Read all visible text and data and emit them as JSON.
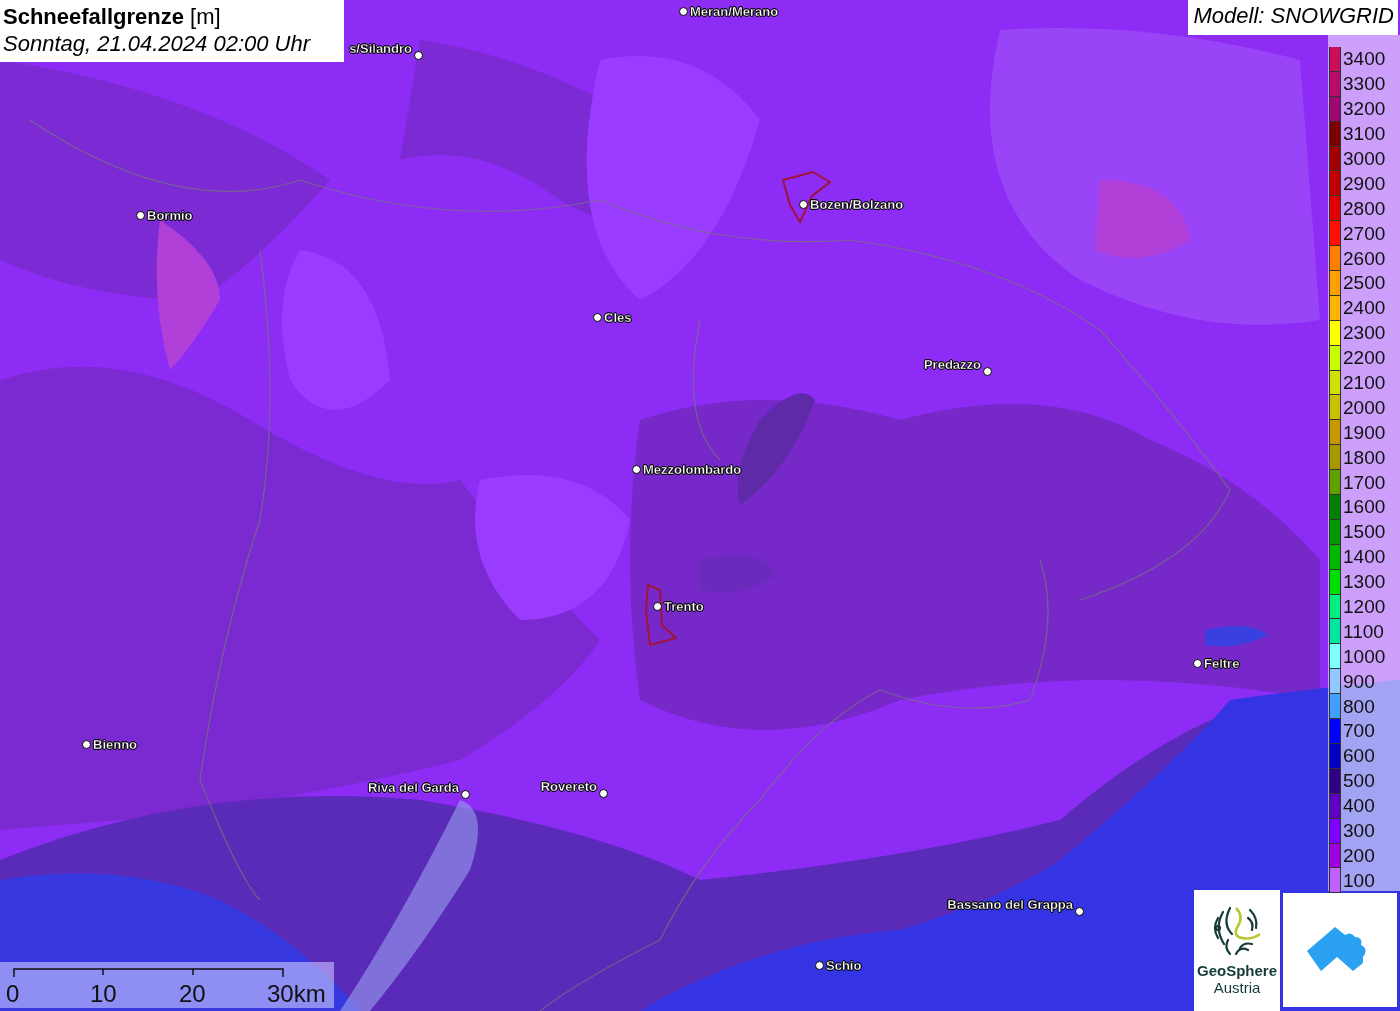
{
  "title": {
    "heading": "**Schneefallgrenze** [m]",
    "datetime": "Sonntag, 21.04.2024 02:00 Uhr"
  },
  "model": "Modell: SNOWGRID",
  "cities": [
    {
      "name": "Meran/Merano"
    },
    {
      "name": "s/Silandro"
    },
    {
      "name": "Bormio"
    },
    {
      "name": "Bozen/Bolzano"
    },
    {
      "name": "Cles"
    },
    {
      "name": "Predazzo"
    },
    {
      "name": "Mezzolombardo"
    },
    {
      "name": "Trento"
    },
    {
      "name": "Feltre"
    },
    {
      "name": "Bienno"
    },
    {
      "name": "Riva del Garda"
    },
    {
      "name": "Rovereto"
    },
    {
      "name": "Bassano del Grappa"
    },
    {
      "name": "Schio"
    }
  ],
  "legend": [
    {
      "label": "3400",
      "color": "#c8105a"
    },
    {
      "label": "3300",
      "color": "#b80c6a"
    },
    {
      "label": "3200",
      "color": "#9c0870"
    },
    {
      "label": "3100",
      "color": "#7a0000"
    },
    {
      "label": "3000",
      "color": "#a00000"
    },
    {
      "label": "2900",
      "color": "#c00000"
    },
    {
      "label": "2800",
      "color": "#e00000"
    },
    {
      "label": "2700",
      "color": "#ff1000"
    },
    {
      "label": "2600",
      "color": "#ff8000"
    },
    {
      "label": "2500",
      "color": "#ffa000"
    },
    {
      "label": "2400",
      "color": "#ffb400"
    },
    {
      "label": "2300",
      "color": "#ffff00"
    },
    {
      "label": "2200",
      "color": "#c8ff00"
    },
    {
      "label": "2100",
      "color": "#d0e000"
    },
    {
      "label": "2000",
      "color": "#c8c000"
    },
    {
      "label": "1900",
      "color": "#c89800"
    },
    {
      "label": "1800",
      "color": "#a89800"
    },
    {
      "label": "1700",
      "color": "#60a000"
    },
    {
      "label": "1600",
      "color": "#008000"
    },
    {
      "label": "1500",
      "color": "#009800"
    },
    {
      "label": "1400",
      "color": "#00b800"
    },
    {
      "label": "1300",
      "color": "#00e000"
    },
    {
      "label": "1200",
      "color": "#00f080"
    },
    {
      "label": "1100",
      "color": "#00e8a0"
    },
    {
      "label": "1000",
      "color": "#80ffff"
    },
    {
      "label": "900",
      "color": "#90c8ff"
    },
    {
      "label": "800",
      "color": "#40a0ff"
    },
    {
      "label": "700",
      "color": "#0000ff"
    },
    {
      "label": "600",
      "color": "#0000c0"
    },
    {
      "label": "500",
      "color": "#300080"
    },
    {
      "label": "400",
      "color": "#6000c0"
    },
    {
      "label": "300",
      "color": "#8000ff"
    },
    {
      "label": "200",
      "color": "#a000e0"
    },
    {
      "label": "100",
      "color": "#c060ff"
    }
  ],
  "scale": {
    "ticks": [
      "0",
      "10",
      "20",
      "30km"
    ]
  },
  "logos": {
    "geosphere": [
      "GeoSphere",
      "Austria"
    ]
  }
}
